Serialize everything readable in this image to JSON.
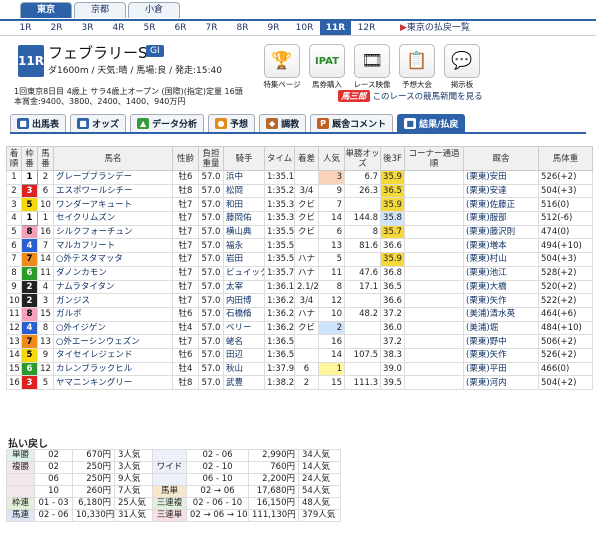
{
  "venues": [
    "東京",
    "京都",
    "小倉"
  ],
  "active_venue": 0,
  "races": [
    "1R",
    "2R",
    "3R",
    "4R",
    "5R",
    "6R",
    "7R",
    "8R",
    "9R",
    "10R",
    "11R",
    "12R"
  ],
  "active_race": 10,
  "race_tabs_link": "東京の払戻一覧",
  "race": {
    "number": "11R",
    "name": "フェブラリーS",
    "grade": "GI",
    "conditions": "ダ1600m / 天気:晴 / 馬場:良 / 発走:15:40",
    "info_line1": "1回東京8日目 4歳上 サラ4歳上オープン (国際)(指定)定量 16頭",
    "info_line2": "本賞金:9400、3800、2400、1400、940万円"
  },
  "tool_icons": [
    {
      "label": "特集ページ",
      "icon": "trophy-icon",
      "glyph": "🏆"
    },
    {
      "label": "馬券購入",
      "icon": "ipat-icon",
      "glyph": "IPAT"
    },
    {
      "label": "レース映像",
      "icon": "film-icon",
      "glyph": "🎞"
    },
    {
      "label": "予想大会",
      "icon": "prediction-icon",
      "glyph": "📋"
    },
    {
      "label": "掲示板",
      "icon": "chat-icon",
      "glyph": "💬"
    }
  ],
  "newspaper": {
    "logo": "馬三郎",
    "text": "このレースの競馬新聞を見る"
  },
  "subtabs": [
    {
      "label": "出馬表",
      "color": "#2d62a8",
      "glyph": "■"
    },
    {
      "label": "オッズ",
      "color": "#2d62a8",
      "glyph": "■"
    },
    {
      "label": "データ分析",
      "color": "#3a9a3a",
      "glyph": "▲"
    },
    {
      "label": "予想",
      "color": "#e08a1a",
      "glyph": "●"
    },
    {
      "label": "調教",
      "color": "#b66a2a",
      "glyph": "◆"
    },
    {
      "label": "厩舎コメント",
      "color": "#c06020",
      "glyph": "P"
    },
    {
      "label": "結果/払戻",
      "color": "#ffffff",
      "glyph": "■"
    }
  ],
  "table_headers": [
    "着順",
    "枠番",
    "馬番",
    "馬名",
    "性齢",
    "負担重量",
    "騎手",
    "タイム",
    "着差",
    "人気",
    "単勝オッズ",
    "後3F",
    "コーナー通過順",
    "厩舎",
    "馬体重"
  ],
  "rows": [
    {
      "pos": "1",
      "waku": "1",
      "uma": "2",
      "name": "グレープブランデー",
      "sex": "牡6",
      "wt": "57.0",
      "jockey": "浜中",
      "time": "1:35.1",
      "margin": "",
      "pop": "3",
      "odds": "6.7",
      "l3f": "35.9",
      "corner": "",
      "stable": "(栗東)安田",
      "bw": "526(+2)"
    },
    {
      "pos": "2",
      "waku": "3",
      "uma": "6",
      "name": "エスポワールシチー",
      "sex": "牡8",
      "wt": "57.0",
      "jockey": "松岡",
      "time": "1:35.2",
      "margin": "3/4",
      "pop": "9",
      "odds": "26.3",
      "l3f": "36.5",
      "corner": "",
      "stable": "(栗東)安達",
      "bw": "504(+3)"
    },
    {
      "pos": "3",
      "waku": "5",
      "uma": "10",
      "name": "ワンダーアキュート",
      "sex": "牡7",
      "wt": "57.0",
      "jockey": "和田",
      "time": "1:35.3",
      "margin": "クビ",
      "pop": "7",
      "odds": "",
      "l3f": "35.9",
      "corner": "",
      "stable": "(栗東)佐藤正",
      "bw": "516(0)"
    },
    {
      "pos": "4",
      "waku": "1",
      "uma": "1",
      "name": "セイクリムズン",
      "sex": "牡7",
      "wt": "57.0",
      "jockey": "藤岡佑",
      "time": "1:35.3",
      "margin": "クビ",
      "pop": "14",
      "odds": "144.8",
      "l3f": "35.8",
      "corner": "",
      "stable": "(栗東)服部",
      "bw": "512(-6)"
    },
    {
      "pos": "5",
      "waku": "8",
      "uma": "16",
      "name": "シルクフォーチュン",
      "sex": "牡7",
      "wt": "57.0",
      "jockey": "横山典",
      "time": "1:35.5",
      "margin": "クビ",
      "pop": "6",
      "odds": "8",
      "l3f": "35.7",
      "corner": "",
      "stable": "(栗東)藤沢則",
      "bw": "474(0)"
    },
    {
      "pos": "6",
      "waku": "4",
      "uma": "7",
      "name": "マルカフリート",
      "sex": "牡7",
      "wt": "57.0",
      "jockey": "福永",
      "time": "1:35.5",
      "margin": "",
      "pop": "13",
      "odds": "81.6",
      "l3f": "36.6",
      "corner": "",
      "stable": "(栗東)増本",
      "bw": "494(+10)"
    },
    {
      "pos": "7",
      "waku": "7",
      "uma": "14",
      "name": "○外テスタマッタ",
      "sex": "牡7",
      "wt": "57.0",
      "jockey": "岩田",
      "time": "1:35.5",
      "margin": "ハナ",
      "pop": "5",
      "odds": "",
      "l3f": "35.9",
      "corner": "",
      "stable": "(栗東)村山",
      "bw": "504(+3)"
    },
    {
      "pos": "8",
      "waku": "6",
      "uma": "11",
      "name": "ダノンカモン",
      "sex": "牡7",
      "wt": "57.0",
      "jockey": "ビュイック",
      "time": "1:35.7",
      "margin": "ハナ",
      "pop": "11",
      "odds": "47.6",
      "l3f": "36.8",
      "corner": "",
      "stable": "(栗東)池江",
      "bw": "528(+2)"
    },
    {
      "pos": "9",
      "waku": "2",
      "uma": "4",
      "name": "ナムラタイタン",
      "sex": "牡7",
      "wt": "57.0",
      "jockey": "太宰",
      "time": "1:36.1",
      "margin": "2.1/2",
      "pop": "8",
      "odds": "17.1",
      "l3f": "36.5",
      "corner": "",
      "stable": "(栗東)大橋",
      "bw": "520(+2)"
    },
    {
      "pos": "10",
      "waku": "2",
      "uma": "3",
      "name": "ガンジス",
      "sex": "牡7",
      "wt": "57.0",
      "jockey": "内田博",
      "time": "1:36.2",
      "margin": "3/4",
      "pop": "12",
      "odds": "",
      "l3f": "36.6",
      "corner": "",
      "stable": "(栗東)矢作",
      "bw": "522(+2)"
    },
    {
      "pos": "11",
      "waku": "8",
      "uma": "15",
      "name": "ガルボ",
      "sex": "牡6",
      "wt": "57.0",
      "jockey": "石橋脩",
      "time": "1:36.2",
      "margin": "ハナ",
      "pop": "10",
      "odds": "48.2",
      "l3f": "37.2",
      "corner": "",
      "stable": "(美浦)清水英",
      "bw": "464(+6)"
    },
    {
      "pos": "12",
      "waku": "4",
      "uma": "8",
      "name": "○外イジゲン",
      "sex": "牡4",
      "wt": "57.0",
      "jockey": "ベリー",
      "time": "1:36.2",
      "margin": "クビ",
      "pop": "2",
      "odds": "",
      "l3f": "36.0",
      "corner": "",
      "stable": "(美浦)堀",
      "bw": "484(+10)"
    },
    {
      "pos": "13",
      "waku": "7",
      "uma": "13",
      "name": "○外エーシンウェズン",
      "sex": "牡7",
      "wt": "57.0",
      "jockey": "蛯名",
      "time": "1:36.5",
      "margin": "",
      "pop": "16",
      "odds": "",
      "l3f": "37.2",
      "corner": "",
      "stable": "(栗東)野中",
      "bw": "506(+2)"
    },
    {
      "pos": "14",
      "waku": "5",
      "uma": "9",
      "name": "タイセイレジェンド",
      "sex": "牡6",
      "wt": "57.0",
      "jockey": "田辺",
      "time": "1:36.5",
      "margin": "",
      "pop": "14",
      "odds": "107.5",
      "l3f": "38.3",
      "corner": "",
      "stable": "(栗東)矢作",
      "bw": "526(+2)"
    },
    {
      "pos": "15",
      "waku": "6",
      "uma": "12",
      "name": "カレンブラックヒル",
      "sex": "牡4",
      "wt": "57.0",
      "jockey": "秋山",
      "time": "1:37.9",
      "margin": "6",
      "pop": "1",
      "odds": "",
      "l3f": "39.0",
      "corner": "",
      "stable": "(栗東)平田",
      "bw": "466(0)"
    },
    {
      "pos": "16",
      "waku": "3",
      "uma": "5",
      "name": "ヤマニンキングリー",
      "sex": "牡8",
      "wt": "57.0",
      "jockey": "武豊",
      "time": "1:38.2",
      "margin": "2",
      "pop": "15",
      "odds": "111.3",
      "l3f": "39.5",
      "corner": "",
      "stable": "(栗東)河内",
      "bw": "504(+2)"
    }
  ],
  "payouts": {
    "title": "払い戻し",
    "left": [
      {
        "type": "単勝",
        "num": "02",
        "amt": "670円",
        "pop": "3人気",
        "cls": "bt-tan"
      },
      {
        "type": "複勝",
        "num": "02",
        "amt": "250円",
        "pop": "3人気",
        "cls": "bt-fuku"
      },
      {
        "type": "",
        "num": "06",
        "amt": "250円",
        "pop": "9人気",
        "cls": "bt-fuku"
      },
      {
        "type": "",
        "num": "10",
        "amt": "260円",
        "pop": "7人気",
        "cls": "bt-fuku"
      },
      {
        "type": "枠連",
        "num": "01 - 03",
        "amt": "6,180円",
        "pop": "25人気",
        "cls": "bt-waku"
      },
      {
        "type": "馬連",
        "num": "02 - 06",
        "amt": "10,330円",
        "pop": "31人気",
        "cls": "bt-umaren"
      }
    ],
    "right": [
      {
        "type": "",
        "num": "02 - 06",
        "amt": "2,990円",
        "pop": "34人気",
        "cls": "bt-wide"
      },
      {
        "type": "ワイド",
        "num": "02 - 10",
        "amt": "760円",
        "pop": "14人気",
        "cls": "bt-wide"
      },
      {
        "type": "",
        "num": "06 - 10",
        "amt": "2,200円",
        "pop": "24人気",
        "cls": "bt-wide"
      },
      {
        "type": "馬単",
        "num": "02 → 06",
        "amt": "17,680円",
        "pop": "54人気",
        "cls": "bt-umatan"
      },
      {
        "type": "三連複",
        "num": "02 - 06 - 10",
        "amt": "16,150円",
        "pop": "48人気",
        "cls": "bt-sanrenpuku"
      },
      {
        "type": "三連単",
        "num": "02 → 06 → 10",
        "amt": "111,130円",
        "pop": "379人気",
        "cls": "bt-sanrentan"
      }
    ]
  }
}
